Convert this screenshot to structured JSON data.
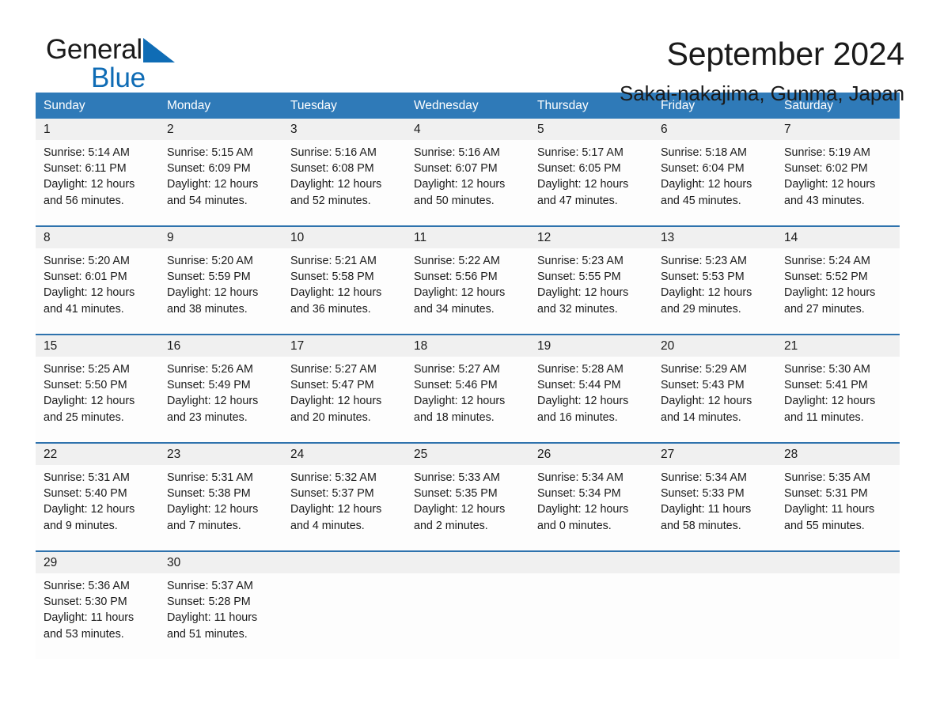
{
  "brand": {
    "name_part1": "General",
    "name_part2": "Blue",
    "triangle_color": "#0f6cb5"
  },
  "header": {
    "title": "September 2024",
    "subtitle": "Sakai-nakajima, Gunma, Japan"
  },
  "theme": {
    "header_blue": "#2f7ab8",
    "separator_blue": "#2e72ad",
    "date_band_gray": "#f0f0f0"
  },
  "weekdays": [
    "Sunday",
    "Monday",
    "Tuesday",
    "Wednesday",
    "Thursday",
    "Friday",
    "Saturday"
  ],
  "weeks": [
    [
      {
        "date": "1",
        "sunrise": "Sunrise: 5:14 AM",
        "sunset": "Sunset: 6:11 PM",
        "daylight": "Daylight: 12 hours and 56 minutes."
      },
      {
        "date": "2",
        "sunrise": "Sunrise: 5:15 AM",
        "sunset": "Sunset: 6:09 PM",
        "daylight": "Daylight: 12 hours and 54 minutes."
      },
      {
        "date": "3",
        "sunrise": "Sunrise: 5:16 AM",
        "sunset": "Sunset: 6:08 PM",
        "daylight": "Daylight: 12 hours and 52 minutes."
      },
      {
        "date": "4",
        "sunrise": "Sunrise: 5:16 AM",
        "sunset": "Sunset: 6:07 PM",
        "daylight": "Daylight: 12 hours and 50 minutes."
      },
      {
        "date": "5",
        "sunrise": "Sunrise: 5:17 AM",
        "sunset": "Sunset: 6:05 PM",
        "daylight": "Daylight: 12 hours and 47 minutes."
      },
      {
        "date": "6",
        "sunrise": "Sunrise: 5:18 AM",
        "sunset": "Sunset: 6:04 PM",
        "daylight": "Daylight: 12 hours and 45 minutes."
      },
      {
        "date": "7",
        "sunrise": "Sunrise: 5:19 AM",
        "sunset": "Sunset: 6:02 PM",
        "daylight": "Daylight: 12 hours and 43 minutes."
      }
    ],
    [
      {
        "date": "8",
        "sunrise": "Sunrise: 5:20 AM",
        "sunset": "Sunset: 6:01 PM",
        "daylight": "Daylight: 12 hours and 41 minutes."
      },
      {
        "date": "9",
        "sunrise": "Sunrise: 5:20 AM",
        "sunset": "Sunset: 5:59 PM",
        "daylight": "Daylight: 12 hours and 38 minutes."
      },
      {
        "date": "10",
        "sunrise": "Sunrise: 5:21 AM",
        "sunset": "Sunset: 5:58 PM",
        "daylight": "Daylight: 12 hours and 36 minutes."
      },
      {
        "date": "11",
        "sunrise": "Sunrise: 5:22 AM",
        "sunset": "Sunset: 5:56 PM",
        "daylight": "Daylight: 12 hours and 34 minutes."
      },
      {
        "date": "12",
        "sunrise": "Sunrise: 5:23 AM",
        "sunset": "Sunset: 5:55 PM",
        "daylight": "Daylight: 12 hours and 32 minutes."
      },
      {
        "date": "13",
        "sunrise": "Sunrise: 5:23 AM",
        "sunset": "Sunset: 5:53 PM",
        "daylight": "Daylight: 12 hours and 29 minutes."
      },
      {
        "date": "14",
        "sunrise": "Sunrise: 5:24 AM",
        "sunset": "Sunset: 5:52 PM",
        "daylight": "Daylight: 12 hours and 27 minutes."
      }
    ],
    [
      {
        "date": "15",
        "sunrise": "Sunrise: 5:25 AM",
        "sunset": "Sunset: 5:50 PM",
        "daylight": "Daylight: 12 hours and 25 minutes."
      },
      {
        "date": "16",
        "sunrise": "Sunrise: 5:26 AM",
        "sunset": "Sunset: 5:49 PM",
        "daylight": "Daylight: 12 hours and 23 minutes."
      },
      {
        "date": "17",
        "sunrise": "Sunrise: 5:27 AM",
        "sunset": "Sunset: 5:47 PM",
        "daylight": "Daylight: 12 hours and 20 minutes."
      },
      {
        "date": "18",
        "sunrise": "Sunrise: 5:27 AM",
        "sunset": "Sunset: 5:46 PM",
        "daylight": "Daylight: 12 hours and 18 minutes."
      },
      {
        "date": "19",
        "sunrise": "Sunrise: 5:28 AM",
        "sunset": "Sunset: 5:44 PM",
        "daylight": "Daylight: 12 hours and 16 minutes."
      },
      {
        "date": "20",
        "sunrise": "Sunrise: 5:29 AM",
        "sunset": "Sunset: 5:43 PM",
        "daylight": "Daylight: 12 hours and 14 minutes."
      },
      {
        "date": "21",
        "sunrise": "Sunrise: 5:30 AM",
        "sunset": "Sunset: 5:41 PM",
        "daylight": "Daylight: 12 hours and 11 minutes."
      }
    ],
    [
      {
        "date": "22",
        "sunrise": "Sunrise: 5:31 AM",
        "sunset": "Sunset: 5:40 PM",
        "daylight": "Daylight: 12 hours and 9 minutes."
      },
      {
        "date": "23",
        "sunrise": "Sunrise: 5:31 AM",
        "sunset": "Sunset: 5:38 PM",
        "daylight": "Daylight: 12 hours and 7 minutes."
      },
      {
        "date": "24",
        "sunrise": "Sunrise: 5:32 AM",
        "sunset": "Sunset: 5:37 PM",
        "daylight": "Daylight: 12 hours and 4 minutes."
      },
      {
        "date": "25",
        "sunrise": "Sunrise: 5:33 AM",
        "sunset": "Sunset: 5:35 PM",
        "daylight": "Daylight: 12 hours and 2 minutes."
      },
      {
        "date": "26",
        "sunrise": "Sunrise: 5:34 AM",
        "sunset": "Sunset: 5:34 PM",
        "daylight": "Daylight: 12 hours and 0 minutes."
      },
      {
        "date": "27",
        "sunrise": "Sunrise: 5:34 AM",
        "sunset": "Sunset: 5:33 PM",
        "daylight": "Daylight: 11 hours and 58 minutes."
      },
      {
        "date": "28",
        "sunrise": "Sunrise: 5:35 AM",
        "sunset": "Sunset: 5:31 PM",
        "daylight": "Daylight: 11 hours and 55 minutes."
      }
    ],
    [
      {
        "date": "29",
        "sunrise": "Sunrise: 5:36 AM",
        "sunset": "Sunset: 5:30 PM",
        "daylight": "Daylight: 11 hours and 53 minutes."
      },
      {
        "date": "30",
        "sunrise": "Sunrise: 5:37 AM",
        "sunset": "Sunset: 5:28 PM",
        "daylight": "Daylight: 11 hours and 51 minutes."
      },
      {
        "date": "",
        "sunrise": "",
        "sunset": "",
        "daylight": ""
      },
      {
        "date": "",
        "sunrise": "",
        "sunset": "",
        "daylight": ""
      },
      {
        "date": "",
        "sunrise": "",
        "sunset": "",
        "daylight": ""
      },
      {
        "date": "",
        "sunrise": "",
        "sunset": "",
        "daylight": ""
      },
      {
        "date": "",
        "sunrise": "",
        "sunset": "",
        "daylight": ""
      }
    ]
  ]
}
